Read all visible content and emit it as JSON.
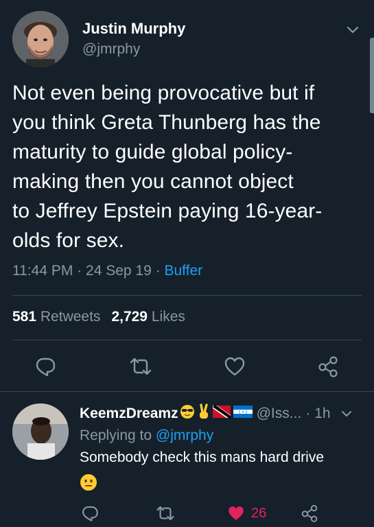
{
  "tweet": {
    "author_name": "Justin Murphy",
    "author_handle": "@jmrphy",
    "text": "Not even being provocative but if you think Greta Thunberg has the maturity to guide global policy-making then you cannot object to Jeffrey Epstein paying 16-year-olds for sex.",
    "text_lines": [
      "Not even being provocative but if",
      "you think Greta Thunberg has the",
      "maturity to guide global policy-",
      "making then you cannot object",
      "to Jeffrey Epstein paying 16-year-",
      "olds for sex."
    ],
    "time": "11:44 PM",
    "date": "24 Sep 19",
    "separator": "·",
    "source": "Buffer",
    "retweets_count": "581",
    "retweets_label": "Retweets",
    "likes_count": "2,729",
    "likes_label": "Likes"
  },
  "reply": {
    "author_name": "KeemzDreamz",
    "author_handle": "@Iss...",
    "time_ago": "1h",
    "separator": "·",
    "replying_prefix": "Replying to",
    "replying_to": "@jmrphy",
    "text": "Somebody check this mans hard drive",
    "like_count": "26"
  },
  "colors": {
    "background": "#15202b",
    "divider": "#38444d",
    "secondary_text": "#8899a6",
    "link": "#1da1f2",
    "like": "#e0245e"
  },
  "icons": {
    "caret": "chevron-down-icon",
    "reply": "reply-icon",
    "retweet": "retweet-icon",
    "like": "heart-icon",
    "share": "share-icon",
    "emojis": [
      "sunglasses-face-emoji",
      "victory-hand-emoji",
      "trinidad-flag-emoji",
      "honduras-flag-emoji",
      "neutral-face-emoji"
    ]
  }
}
